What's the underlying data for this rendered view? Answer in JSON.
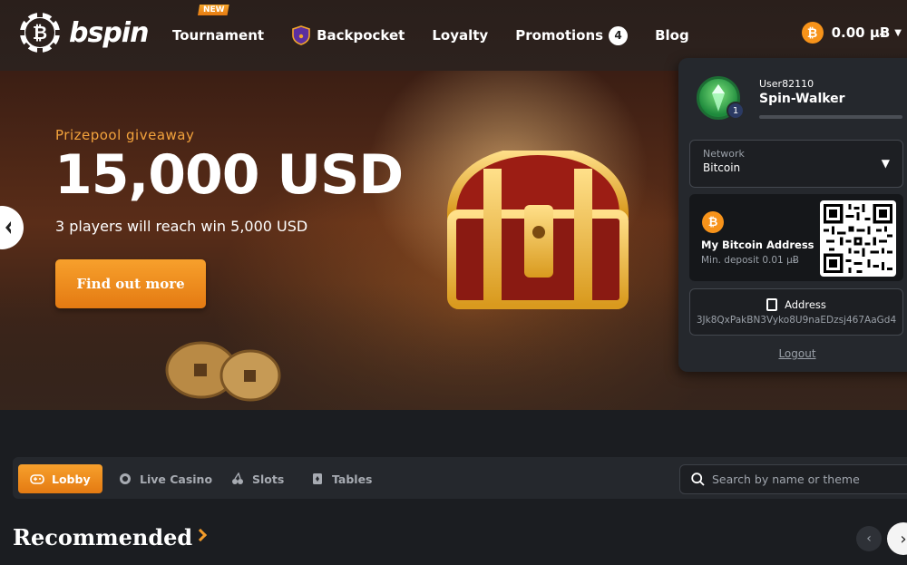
{
  "brand": {
    "name": "bspin"
  },
  "nav": {
    "tournament": {
      "label": "Tournament",
      "badge": "NEW"
    },
    "backpocket": {
      "label": "Backpocket"
    },
    "loyalty": {
      "label": "Loyalty"
    },
    "promotions": {
      "label": "Promotions",
      "count": "4"
    },
    "blog": {
      "label": "Blog"
    }
  },
  "balance": {
    "coin_symbol": "₿",
    "amount": "0.00 µɃ"
  },
  "hero": {
    "subtitle": "Prizepool giveaway",
    "title": "15,000 USD",
    "text": "3 players will reach win 5,000 USD",
    "button": "Find out more"
  },
  "user_panel": {
    "user_id": "User82110",
    "user_name": "Spin-Walker",
    "level": "1",
    "network_label": "Network",
    "network_value": "Bitcoin",
    "address_title": "My Bitcoin Address",
    "min_deposit": "Min. deposit 0.01 µɃ",
    "coin_symbol": "₿",
    "address_label": "Address",
    "address_value": "3Jk8QxPakBN3Vyko8U9naEDzsj467AaGd4",
    "logout": "Logout"
  },
  "tabs": {
    "lobby": "Lobby",
    "live_casino": "Live Casino",
    "slots": "Slots",
    "tables": "Tables"
  },
  "search": {
    "placeholder": "Search by name or theme"
  },
  "recommended": {
    "title": "Recommended"
  },
  "colors": {
    "accent": "#f39c2a",
    "bitcoin": "#f7931a",
    "panel": "#25282d",
    "background": "#1b1d21"
  }
}
